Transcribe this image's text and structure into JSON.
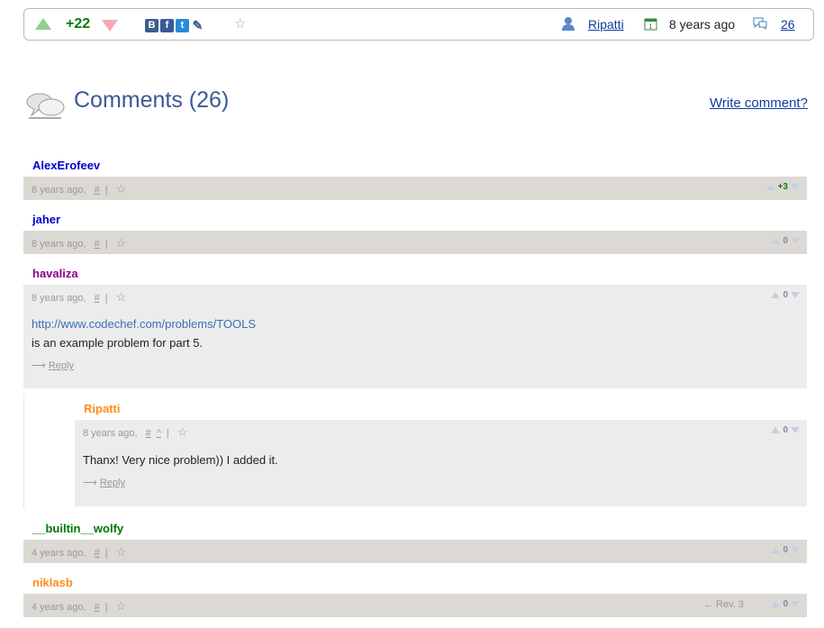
{
  "topbar": {
    "rating": "+22",
    "social": [
      {
        "name": "vk-icon",
        "glyph": "B",
        "color": "#3b5e8c"
      },
      {
        "name": "facebook-icon",
        "glyph": "f",
        "color": "#3b5998"
      },
      {
        "name": "twitter-icon",
        "glyph": "t",
        "color": "#2a8ad8"
      },
      {
        "name": "pencil-icon",
        "glyph": "✎",
        "color": "#3b5998"
      }
    ],
    "author": "Ripatti",
    "date": "8 years ago",
    "comment_count": "26"
  },
  "comments_header": {
    "title": "Comments (26)",
    "write_link": "Write comment?"
  },
  "comments": [
    {
      "author": "AlexErofeev",
      "author_color": "#0000cc",
      "time": "8 years ago,",
      "rating": "+3",
      "rating_color": "#0a7a0a"
    },
    {
      "author": "jaher",
      "author_color": "#0000cc",
      "time": "8 years ago,",
      "rating": "0",
      "rating_color": "#888888"
    },
    {
      "author": "havaliza",
      "author_color": "#8a008a",
      "time": "8 years ago,",
      "rating": "0",
      "rating_color": "#888888",
      "link": "http://www.codechef.com/problems/TOOLS",
      "text": "is an example problem for part 5.",
      "reply": "Reply"
    },
    {
      "author": "Ripatti",
      "author_color": "#ff8c1a",
      "time": "8 years ago,",
      "rating": "0",
      "rating_color": "#888888",
      "text": "Thanx! Very nice problem)) I added it.",
      "reply": "Reply"
    },
    {
      "author": "__builtin__wolfy",
      "author_color": "#007700",
      "time": "4 years ago,",
      "rating": "0",
      "rating_color": "#888888"
    },
    {
      "author": "niklasb",
      "author_color": "#ff8c1a",
      "time": "4 years ago,",
      "rating": "0",
      "rating_color": "#888888",
      "revision": "← Rev. 3"
    }
  ],
  "labels": {
    "hash": "#",
    "parent": "^",
    "reply_arrow": "⟶"
  }
}
